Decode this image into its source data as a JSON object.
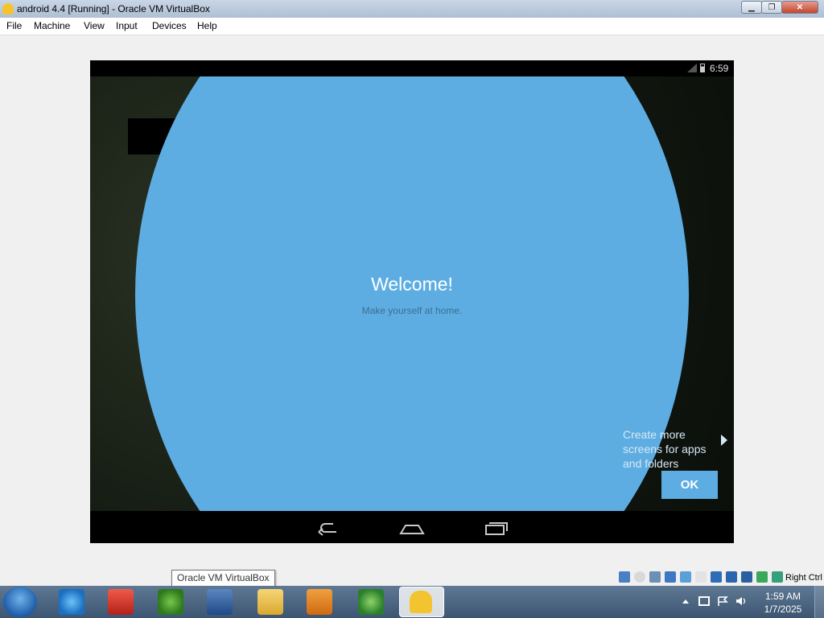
{
  "window": {
    "title": "android 4.4 [Running] - Oracle VM VirtualBox",
    "minimize_label": "▁",
    "maximize_label": "❐",
    "close_label": "✕"
  },
  "menu": {
    "items": [
      "File",
      "Machine",
      "View",
      "Input",
      "Devices",
      "Help"
    ]
  },
  "android": {
    "clock": "6:59",
    "welcome_title": "Welcome!",
    "welcome_subtitle": "Make yourself at home.",
    "hint": "Create more screens for apps and folders",
    "ok_label": "OK",
    "accent_color": "#5dade2",
    "nav_icons": [
      "back-icon",
      "home-icon",
      "recent-apps-icon"
    ]
  },
  "tooltip": "Oracle VM VirtualBox",
  "vbox_status": {
    "host_key": "Right Ctrl",
    "icons": [
      "hard-disk-icon",
      "optical-drive-icon",
      "audio-icon",
      "network-icon",
      "usb-icon",
      "shared-folders-icon",
      "display-icon",
      "video-capture-icon",
      "cpu-icon",
      "mouse-integration-icon",
      "keyboard-icon"
    ]
  },
  "taskbar": {
    "apps": [
      "internet-explorer-icon",
      "app-red-icon",
      "download-manager-icon",
      "virtualbox-icon",
      "file-explorer-icon",
      "media-player-icon",
      "network-globe-icon",
      "android-vm-icon"
    ],
    "time": "1:59 AM",
    "date": "1/7/2025",
    "tray_icons": [
      "show-hidden-icons-icon",
      "network-tray-icon",
      "action-center-icon",
      "volume-icon"
    ]
  }
}
